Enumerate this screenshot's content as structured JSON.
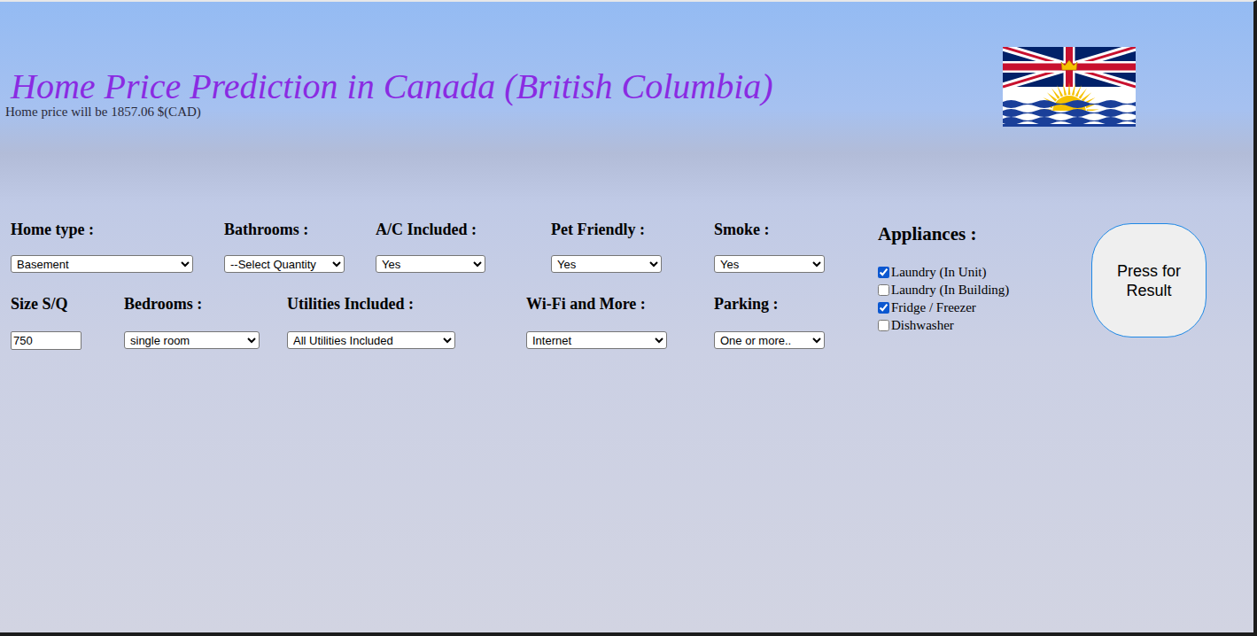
{
  "page": {
    "title": "Home Price Prediction in Canada (British Columbia)",
    "result": "Home price will be 1857.06 $(CAD)"
  },
  "form": {
    "rows": [
      [
        {
          "label": "Home type :",
          "kind": "select",
          "value": "Basement"
        },
        {
          "label": "Bathrooms :",
          "kind": "select",
          "value": "--Select Quantity"
        },
        {
          "label": "A/C Included :",
          "kind": "select",
          "value": "Yes"
        },
        {
          "label": "Pet Friendly :",
          "kind": "select",
          "value": "Yes"
        },
        {
          "label": "Smoke :",
          "kind": "select",
          "value": "Yes"
        }
      ],
      [
        {
          "label": "Size S/Q",
          "kind": "text",
          "value": "750"
        },
        {
          "label": "Bedrooms :",
          "kind": "select",
          "value": "single room"
        },
        {
          "label": "Utilities Included :",
          "kind": "select",
          "value": "All Utilities Included"
        },
        {
          "label": "Wi-Fi and More :",
          "kind": "select",
          "value": "Internet"
        },
        {
          "label": "Parking :",
          "kind": "select",
          "value": "One or more.."
        }
      ]
    ]
  },
  "appliances": {
    "heading": "Appliances :",
    "items": [
      {
        "label": "Laundry (In Unit)",
        "checked": true
      },
      {
        "label": "Laundry (In Building)",
        "checked": false
      },
      {
        "label": "Fridge / Freezer",
        "checked": true
      },
      {
        "label": "Dishwasher",
        "checked": false
      }
    ]
  },
  "button": "Press for Result"
}
